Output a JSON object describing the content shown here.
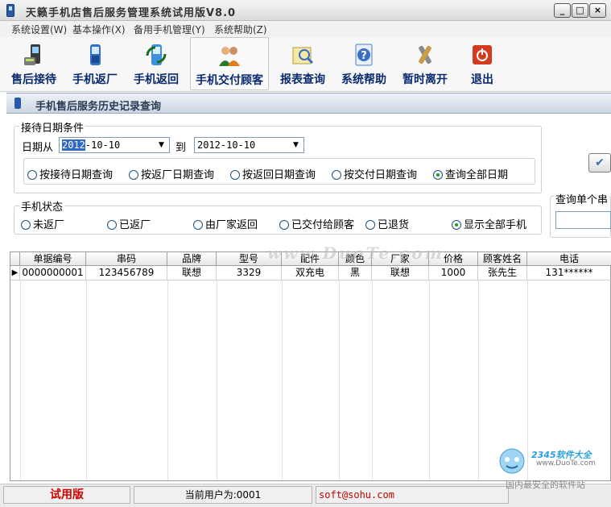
{
  "window": {
    "title": "天籁手机店售后服务管理系统试用版V8.0"
  },
  "menu": [
    {
      "label": "系统设置(W)"
    },
    {
      "label": "基本操作(X)"
    },
    {
      "label": "备用手机管理(Y)"
    },
    {
      "label": "系统帮助(Z)"
    }
  ],
  "toolbar": [
    {
      "label": "售后接待",
      "icon": "phone-reception-icon"
    },
    {
      "label": "手机返厂",
      "icon": "phone-return-factory-icon"
    },
    {
      "label": "手机返回",
      "icon": "phone-returned-icon"
    },
    {
      "label": "手机交付顾客",
      "icon": "deliver-to-customer-icon"
    },
    {
      "label": "报表查询",
      "icon": "report-query-icon"
    },
    {
      "label": "系统帮助",
      "icon": "help-icon"
    },
    {
      "label": "暂时离开",
      "icon": "tools-leave-icon"
    },
    {
      "label": "退出",
      "icon": "power-exit-icon"
    }
  ],
  "panel": {
    "title": "手机售后服务历史记录查询"
  },
  "date_group": {
    "title": "接待日期条件",
    "from_label": "日期从",
    "from_year": "2012",
    "from_rest": "-10-10",
    "to_label": "到",
    "to_value": "2012-10-10",
    "options": [
      {
        "label": "按接待日期查询",
        "checked": false
      },
      {
        "label": "按返厂日期查询",
        "checked": false
      },
      {
        "label": "按返回日期查询",
        "checked": false
      },
      {
        "label": "按交付日期查询",
        "checked": false
      },
      {
        "label": "查询全部日期",
        "checked": true
      }
    ]
  },
  "status_group": {
    "title": "手机状态",
    "options": [
      {
        "label": "未返厂",
        "checked": false
      },
      {
        "label": "已返厂",
        "checked": false
      },
      {
        "label": "由厂家返回",
        "checked": false
      },
      {
        "label": "已交付给顾客",
        "checked": false
      },
      {
        "label": "已退货",
        "checked": false
      },
      {
        "label": "显示全部手机",
        "checked": true
      }
    ]
  },
  "single_query": {
    "title": "查询单个串"
  },
  "table": {
    "columns": [
      "单据编号",
      "串码",
      "品牌",
      "型号",
      "配件",
      "颜色",
      "厂家",
      "价格",
      "顾客姓名",
      "电话"
    ],
    "rows": [
      [
        "0000000001",
        "123456789",
        "联想",
        "3329",
        "双充电",
        "黑",
        "联想",
        "1000",
        "张先生",
        "131******"
      ]
    ]
  },
  "status": {
    "trial": "试用版",
    "user": "当前用户为:0001",
    "email": "soft@sohu.com"
  },
  "watermark": {
    "text": "www.DuoTe.com"
  },
  "corner_logo": {
    "brand": "2345软件大全",
    "url": "www.DuoTe.com",
    "slogan": "国内最安全的软件站"
  },
  "colors": {
    "toolbar_label": "#0a2a6e",
    "trial": "#d00000",
    "email": "#c00000",
    "selection": "#316ac5"
  }
}
